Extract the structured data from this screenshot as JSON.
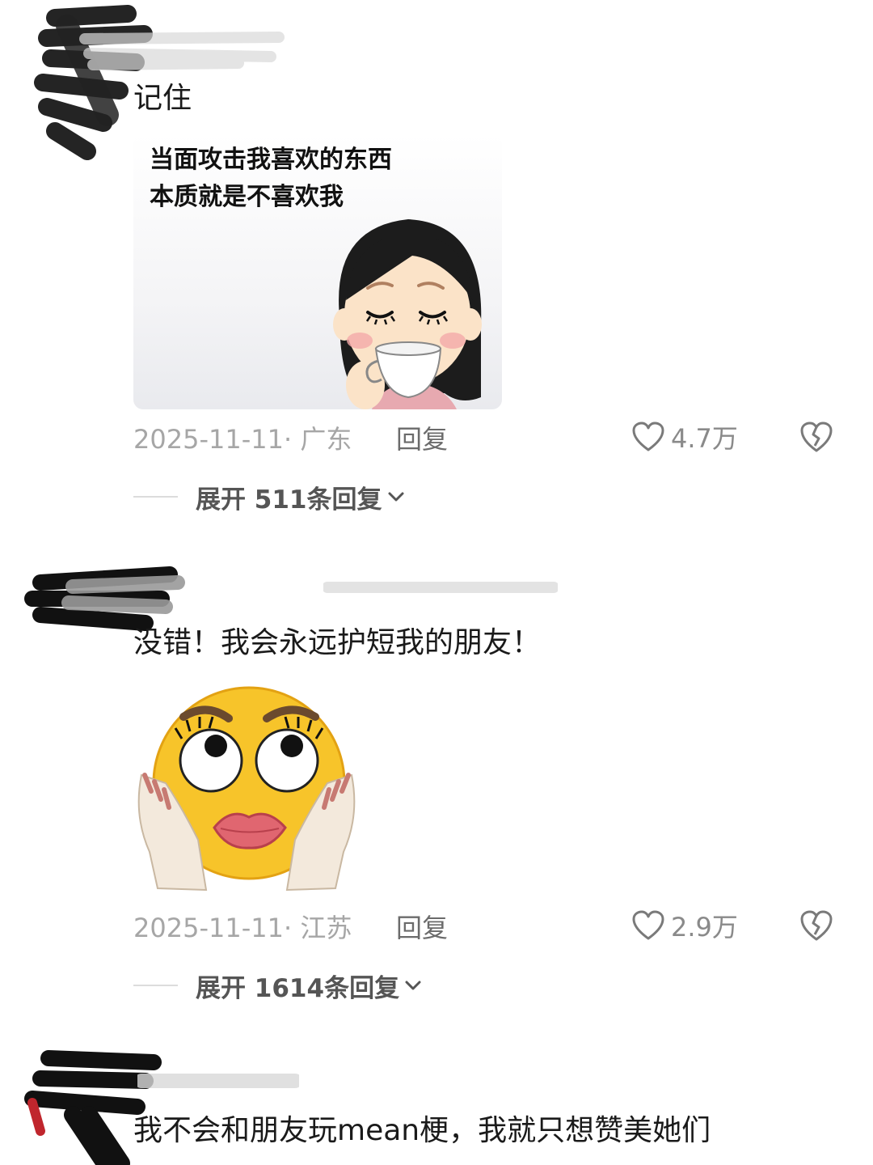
{
  "comments": [
    {
      "text": "记住",
      "sticker_caption": [
        "当面攻击我喜欢的东西",
        "本质就是不喜欢我"
      ],
      "date_location": "2025-11-11· 广东",
      "reply_label": "回复",
      "likes": "4.7万",
      "expand_label": "展开 511条回复"
    },
    {
      "text": "没错！我会永远护短我的朋友！",
      "date_location": "2025-11-11· 江苏",
      "reply_label": "回复",
      "likes": "2.9万",
      "expand_label": "展开 1614条回复"
    },
    {
      "text": "我不会和朋友玩mean梗，我就只想赞美她们"
    }
  ],
  "icons": {
    "like": "heart-outline-icon",
    "dislike": "broken-heart-icon",
    "expand": "chevron-down-icon"
  },
  "colors": {
    "meta_text": "#a6a6a6",
    "reply_text": "#6b6b6b",
    "expand_text": "#555555"
  }
}
